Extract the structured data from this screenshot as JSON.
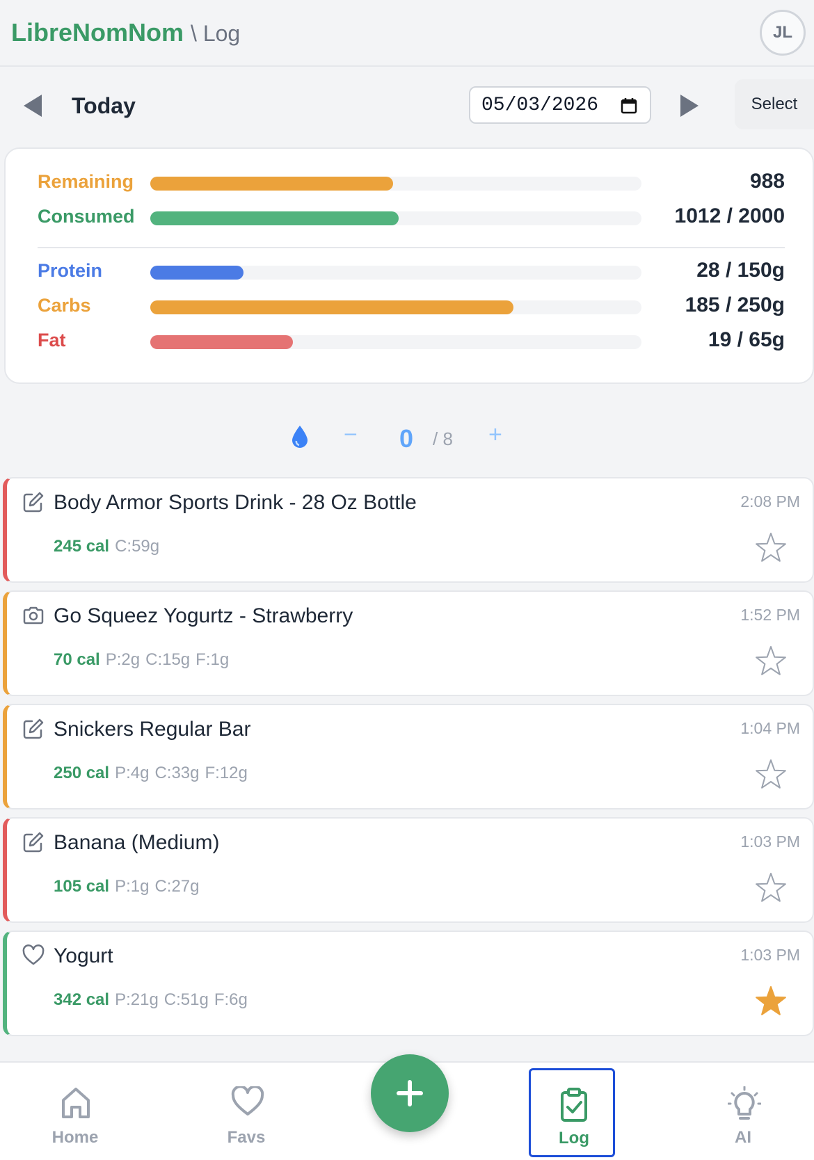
{
  "header": {
    "brand": "LibreNomNom",
    "crumb": "\\ Log",
    "avatar": "JL"
  },
  "datebar": {
    "day_label": "Today",
    "date": "05/03/2026",
    "select_label": "Select"
  },
  "summary": {
    "remaining": {
      "label": "Remaining",
      "value": "988",
      "fraction": 0.494,
      "color": "#eba23b"
    },
    "consumed": {
      "label": "Consumed",
      "value": "1012 / 2000",
      "fraction": 0.506,
      "color": "#52b37e"
    },
    "protein": {
      "label": "Protein",
      "value": "28 / 150g",
      "fraction": 0.19,
      "color": "#4b7be5"
    },
    "carbs": {
      "label": "Carbs",
      "value": "185 / 250g",
      "fraction": 0.74,
      "color": "#eba23b"
    },
    "fat": {
      "label": "Fat",
      "value": "19 / 65g",
      "fraction": 0.29,
      "color": "#e57373"
    }
  },
  "water": {
    "count": "0",
    "goal": "/ 8",
    "minus": "−",
    "plus": "+"
  },
  "entries": [
    {
      "name": "Body Armor Sports Drink - 28 Oz Bottle",
      "time": "2:08 PM",
      "cal": "245 cal",
      "macros": [
        "C:59g"
      ],
      "type_icon": "edit-icon",
      "starred": false,
      "accent": "#e25b5b"
    },
    {
      "name": "Go Squeez Yogurtz - Strawberry",
      "time": "1:52 PM",
      "cal": "70 cal",
      "macros": [
        "P:2g",
        "C:15g",
        "F:1g"
      ],
      "type_icon": "camera-icon",
      "starred": false,
      "accent": "#eba23b"
    },
    {
      "name": "Snickers Regular Bar",
      "time": "1:04 PM",
      "cal": "250 cal",
      "macros": [
        "P:4g",
        "C:33g",
        "F:12g"
      ],
      "type_icon": "edit-icon",
      "starred": false,
      "accent": "#eba23b"
    },
    {
      "name": "Banana (Medium)",
      "time": "1:03 PM",
      "cal": "105 cal",
      "macros": [
        "P:1g",
        "C:27g"
      ],
      "type_icon": "edit-icon",
      "starred": false,
      "accent": "#e25b5b"
    },
    {
      "name": "Yogurt",
      "time": "1:03 PM",
      "cal": "342 cal",
      "macros": [
        "P:21g",
        "C:51g",
        "F:6g"
      ],
      "type_icon": "heart-icon",
      "starred": true,
      "accent": "#52b37e"
    }
  ],
  "nav": {
    "home": "Home",
    "favs": "Favs",
    "log": "Log",
    "ai": "AI",
    "active": "log"
  }
}
